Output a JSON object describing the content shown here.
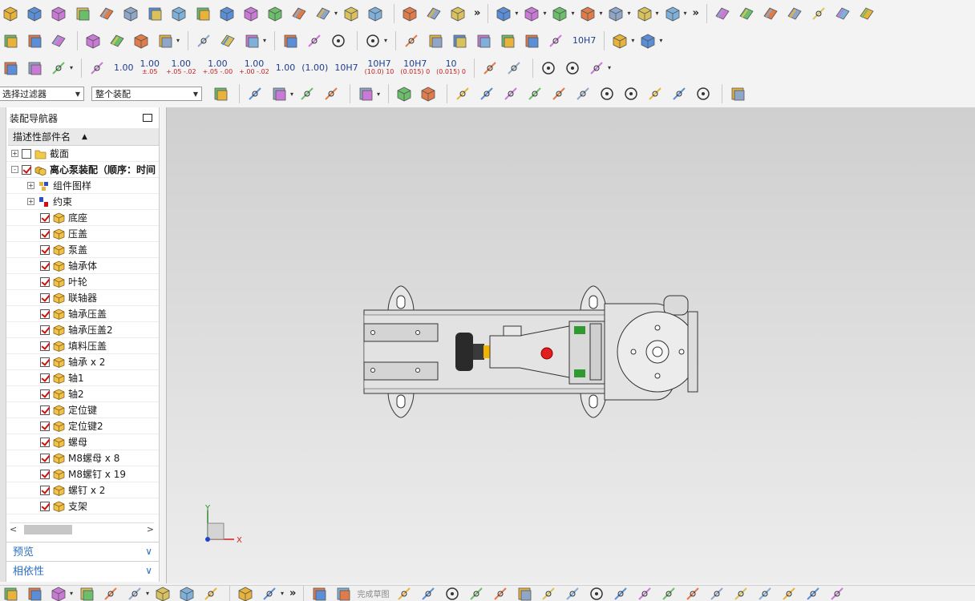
{
  "colors": {
    "accent_blue": "#2a6fbf",
    "check_red": "#d01010",
    "viewport_top": "#cfcfcf",
    "viewport_bottom": "#ededed",
    "part_yellow": "#e8b33a"
  },
  "toolbar_row3": {
    "tolerances": [
      {
        "main": "1.00",
        "sub": ""
      },
      {
        "main": "1.00",
        "sub": "±.05"
      },
      {
        "main": "1.00",
        "sub": "+.05 -.02"
      },
      {
        "main": "1.00",
        "sub": "+.05 -.00"
      },
      {
        "main": "1.00",
        "sub": "+.00 -.02"
      },
      {
        "main": "1.00",
        "sub": ""
      },
      {
        "main": "(1.00)",
        "sub": ""
      },
      {
        "main": "10H7",
        "sub": ""
      },
      {
        "main": "10H7",
        "sub": "(10.0) 10"
      },
      {
        "main": "10H7",
        "sub": "(0.015) 0"
      },
      {
        "main": "10",
        "sub": "(0.015) 0"
      }
    ],
    "fit_label": "10H7"
  },
  "selection_bar": {
    "filter_label": "选择过滤器",
    "scope_label": "整个装配"
  },
  "navigator": {
    "title": "装配导航器",
    "column_header": "描述性部件名",
    "tree": [
      {
        "label": "截面",
        "level": 0,
        "expander": "+",
        "checked": false,
        "icon": "folder-icon"
      },
      {
        "label": "离心泵装配（顺序：时间",
        "level": 0,
        "expander": "−",
        "checked": true,
        "icon": "assembly-icon",
        "bold": true
      },
      {
        "label": "组件图样",
        "level": 1,
        "expander": "+",
        "checked": null,
        "icon": "drawing-pattern-icon"
      },
      {
        "label": "约束",
        "level": 1,
        "expander": "+",
        "checked": null,
        "icon": "constraint-icon"
      },
      {
        "label": "底座",
        "level": 2,
        "checked": true,
        "icon": "part-icon"
      },
      {
        "label": "压盖",
        "level": 2,
        "checked": true,
        "icon": "part-icon"
      },
      {
        "label": "泵盖",
        "level": 2,
        "checked": true,
        "icon": "part-icon"
      },
      {
        "label": "轴承体",
        "level": 2,
        "checked": true,
        "icon": "part-icon"
      },
      {
        "label": "叶轮",
        "level": 2,
        "checked": true,
        "icon": "part-icon"
      },
      {
        "label": "联轴器",
        "level": 2,
        "checked": true,
        "icon": "part-icon"
      },
      {
        "label": "轴承压盖",
        "level": 2,
        "checked": true,
        "icon": "part-icon"
      },
      {
        "label": "轴承压盖2",
        "level": 2,
        "checked": true,
        "icon": "part-icon"
      },
      {
        "label": "填料压盖",
        "level": 2,
        "checked": true,
        "icon": "part-icon"
      },
      {
        "label": "轴承 x 2",
        "level": 2,
        "checked": true,
        "icon": "part-icon"
      },
      {
        "label": "轴1",
        "level": 2,
        "checked": true,
        "icon": "part-icon"
      },
      {
        "label": "轴2",
        "level": 2,
        "checked": true,
        "icon": "part-icon"
      },
      {
        "label": "定位键",
        "level": 2,
        "checked": true,
        "icon": "part-icon"
      },
      {
        "label": "定位键2",
        "level": 2,
        "checked": true,
        "icon": "part-icon"
      },
      {
        "label": "螺母",
        "level": 2,
        "checked": true,
        "icon": "part-icon"
      },
      {
        "label": "M8螺母 x 8",
        "level": 2,
        "checked": true,
        "icon": "part-icon"
      },
      {
        "label": "M8螺钉 x 19",
        "level": 2,
        "checked": true,
        "icon": "part-icon"
      },
      {
        "label": "螺钉 x 2",
        "level": 2,
        "checked": true,
        "icon": "part-icon"
      },
      {
        "label": "支架",
        "level": 2,
        "checked": true,
        "icon": "part-icon"
      }
    ],
    "scroll_left": "<",
    "scroll_right": ">",
    "sections": [
      {
        "label": "预览"
      },
      {
        "label": "相依性"
      }
    ]
  },
  "viewport": {
    "axis_y": "Y",
    "axis_x": "X"
  },
  "bottom_toolbar": {
    "finish_sketch_label": "完成草图"
  }
}
